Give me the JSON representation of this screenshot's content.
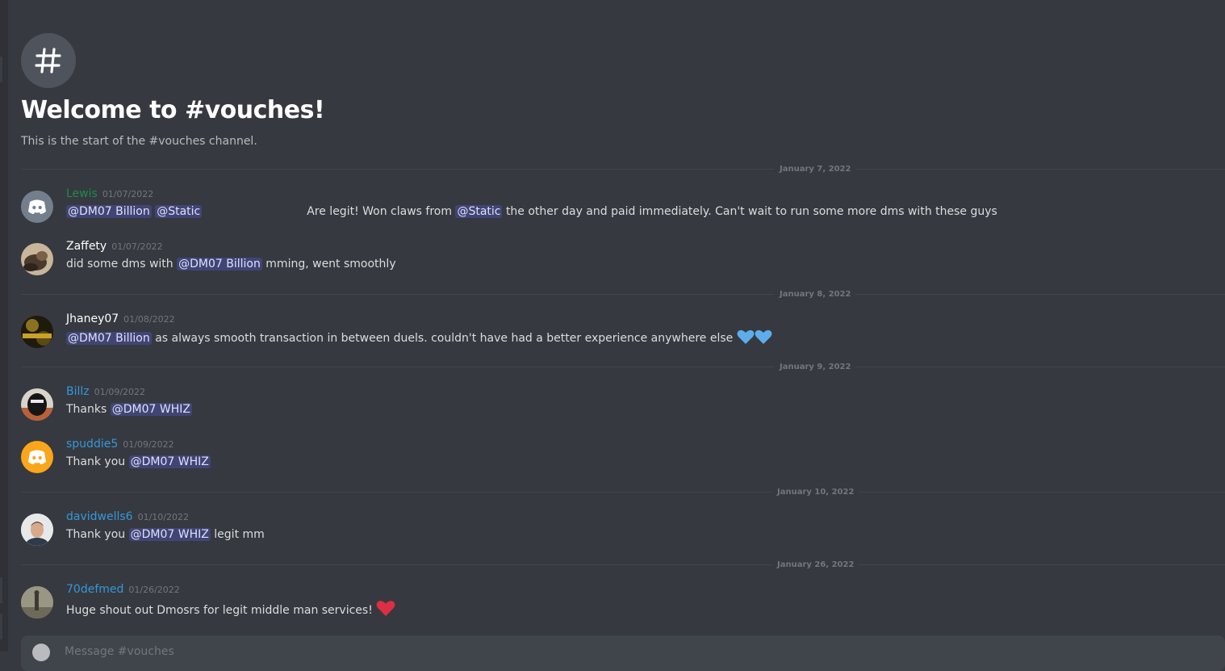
{
  "channel": {
    "welcome_title": "Welcome to #vouches!",
    "welcome_subtitle": "This is the start of the #vouches channel.",
    "composer_placeholder": "Message #vouches"
  },
  "dividers": [
    {
      "label": "January 7, 2022"
    },
    {
      "label": "January 8, 2022"
    },
    {
      "label": "January 9, 2022"
    },
    {
      "label": "January 10, 2022"
    },
    {
      "label": "January 26, 2022"
    }
  ],
  "messages": [
    {
      "author": "Lewis",
      "author_color": "#1f8b4c",
      "timestamp": "01/07/2022",
      "mention1": "@DM07 Billion",
      "mention2": "@Static",
      "text1": "Are legit! Won claws from",
      "mention3": "@Static",
      "text2": "the other day and paid immediately. Can't wait to run some more dms with these guys"
    },
    {
      "author": "Zaffety",
      "author_color": "#ffffff",
      "timestamp": "01/07/2022",
      "text1": "did some dms with",
      "mention1": "@DM07 Billion",
      "text2": "mming, went smoothly"
    },
    {
      "author": "Jhaney07",
      "author_color": "#ffffff",
      "timestamp": "01/08/2022",
      "mention1": "@DM07 Billion",
      "text1": "as always smooth transaction in between duels. couldn't have had a better experience anywhere else",
      "emoji": "blue-heart"
    },
    {
      "author": "Billz",
      "author_color": "#3498db",
      "timestamp": "01/09/2022",
      "text1": "Thanks",
      "mention1": "@DM07 WHIZ"
    },
    {
      "author": "spuddie5",
      "author_color": "#3498db",
      "timestamp": "01/09/2022",
      "text1": "Thank you",
      "mention1": "@DM07 WHIZ"
    },
    {
      "author": "davidwells6",
      "author_color": "#3498db",
      "timestamp": "01/10/2022",
      "text1": "Thank you",
      "mention1": "@DM07 WHIZ",
      "text2": "legit mm"
    },
    {
      "author": "70defmed",
      "author_color": "#3498db",
      "timestamp": "01/26/2022",
      "text1": "Huge shout out Dmosrs for legit middle man services!",
      "emoji": "red-heart"
    }
  ],
  "colors": {
    "background": "#36393f",
    "mention_bg": "#414675",
    "timestamp": "#72767d",
    "blue_heart": "#5dadec",
    "red_heart": "#dd2e44"
  }
}
